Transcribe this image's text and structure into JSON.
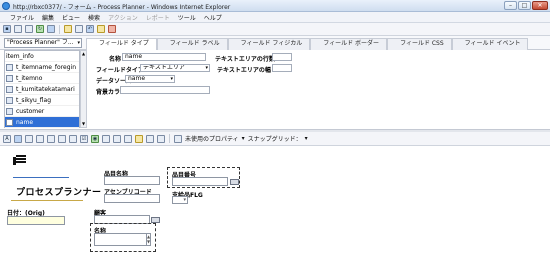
{
  "window": {
    "title": "http://rbxc0377/ - フォーム - Process Planner - Windows Internet Explorer",
    "btn_min": "–",
    "btn_max": "□",
    "btn_close": "✕"
  },
  "menu": [
    "ファイル",
    "編集",
    "ビュー",
    "検索",
    "アクション",
    "レポート",
    "ツール",
    "ヘルプ"
  ],
  "menu_disabled": [
    4,
    5
  ],
  "object_dropdown": "\"Process Planner\" フ...",
  "tabs": [
    "フィールド タイプ",
    "フィールド ラベル",
    "フィールド フィジカル",
    "フィールド ボーダー",
    "フィールド CSS",
    "フィールド イベント"
  ],
  "field_list": [
    "item_info",
    "t_itemname_foregin",
    "t_itemno",
    "t_kumitatekatamari",
    "t_sikyu_flag",
    "customer",
    "name"
  ],
  "field_list_selected": 6,
  "properties": {
    "name_label": "名称",
    "name_value": "name",
    "field_type_label": "フィールドタイプ",
    "field_type_value": "テキストエリア",
    "datasource_label": "データソース",
    "datasource_value": "name",
    "bg_color_label": "背景カラー",
    "bg_color_value": "",
    "textarea_rows_label": "テキストエリアの行数",
    "textarea_rows_value": "",
    "textarea_width_label": "テキストエリアの幅",
    "textarea_width_value": ""
  },
  "design_toolbar": {
    "unused_props": "未使用のプロパティ",
    "snap_grid": "スナップグリッド："
  },
  "form": {
    "app_title": "プロセスプランナー",
    "date_label": "日付：(Orig)",
    "item_name_label": "品目名称",
    "item_no_label": "品目番号",
    "assembly_code_label": "アセンブリコード",
    "supply_flag_label": "支給品FLG",
    "customer_label": "顧客",
    "name_label": "名称"
  }
}
